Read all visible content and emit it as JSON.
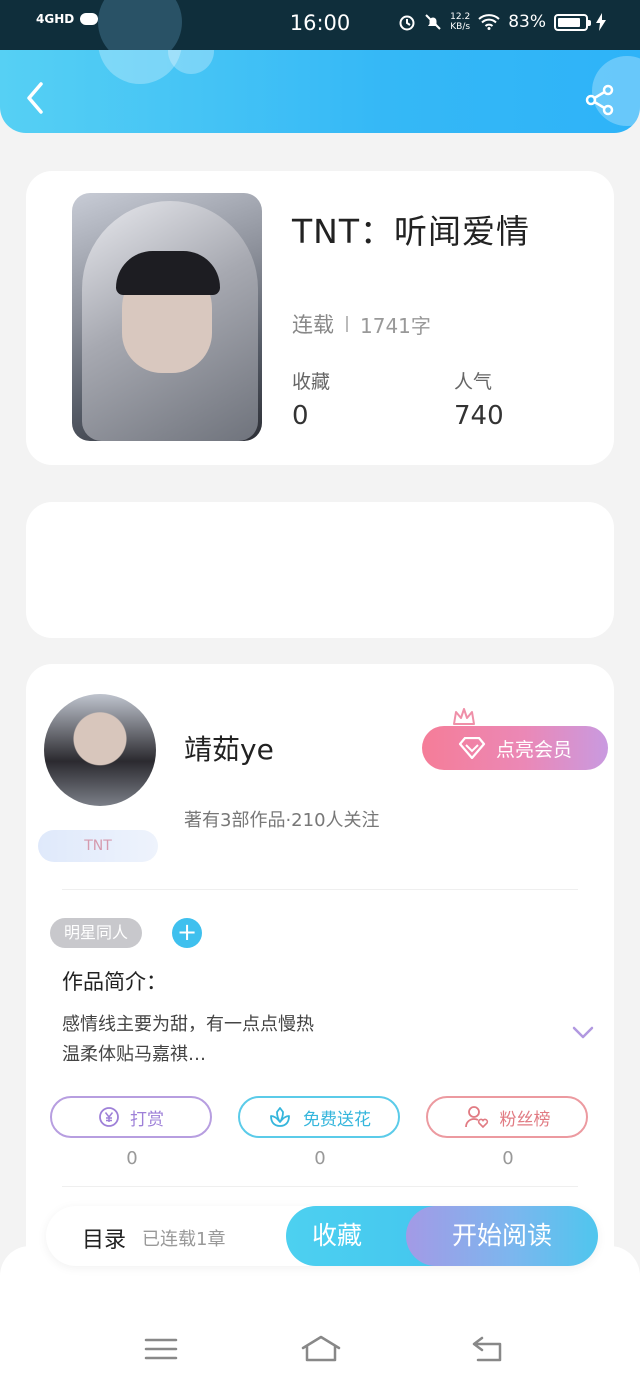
{
  "status_bar": {
    "network": "4GHD",
    "time": "16:00",
    "speed_value": "12.2",
    "speed_unit": "KB/s",
    "battery": "83%"
  },
  "header": {
    "back_icon": "chevron-left-icon",
    "share_icon": "share-icon"
  },
  "book": {
    "title": "TNT：听闻爱情",
    "status": "连载",
    "word_count": "1741字",
    "favorites_label": "收藏",
    "favorites_value": "0",
    "popularity_label": "人气",
    "popularity_value": "740"
  },
  "author": {
    "name": "靖茹ye",
    "info": "著有3部作品·210人关注",
    "tag": "TNT",
    "vip_button": "点亮会员"
  },
  "intro": {
    "genre_tag": "明星同人",
    "add_label": "+",
    "title": "作品简介：",
    "line1": "感情线主要为甜，有一点点慢热",
    "line2": "温柔体贴马嘉祺…"
  },
  "actions": {
    "reward_label": "打赏",
    "reward_count": "0",
    "flower_label": "免费送花",
    "flower_count": "0",
    "fans_label": "粉丝榜",
    "fans_count": "0"
  },
  "read_bar": {
    "toc_label": "目录",
    "chapters": "已连载1章",
    "collect_label": "收藏",
    "read_label": "开始阅读"
  },
  "colors": {
    "header_start": "#56d0f4",
    "header_end": "#2eb3f8",
    "vip_start": "#f57d98",
    "vip_end": "#c99ae0",
    "accent_blue": "#3fc0ee"
  }
}
